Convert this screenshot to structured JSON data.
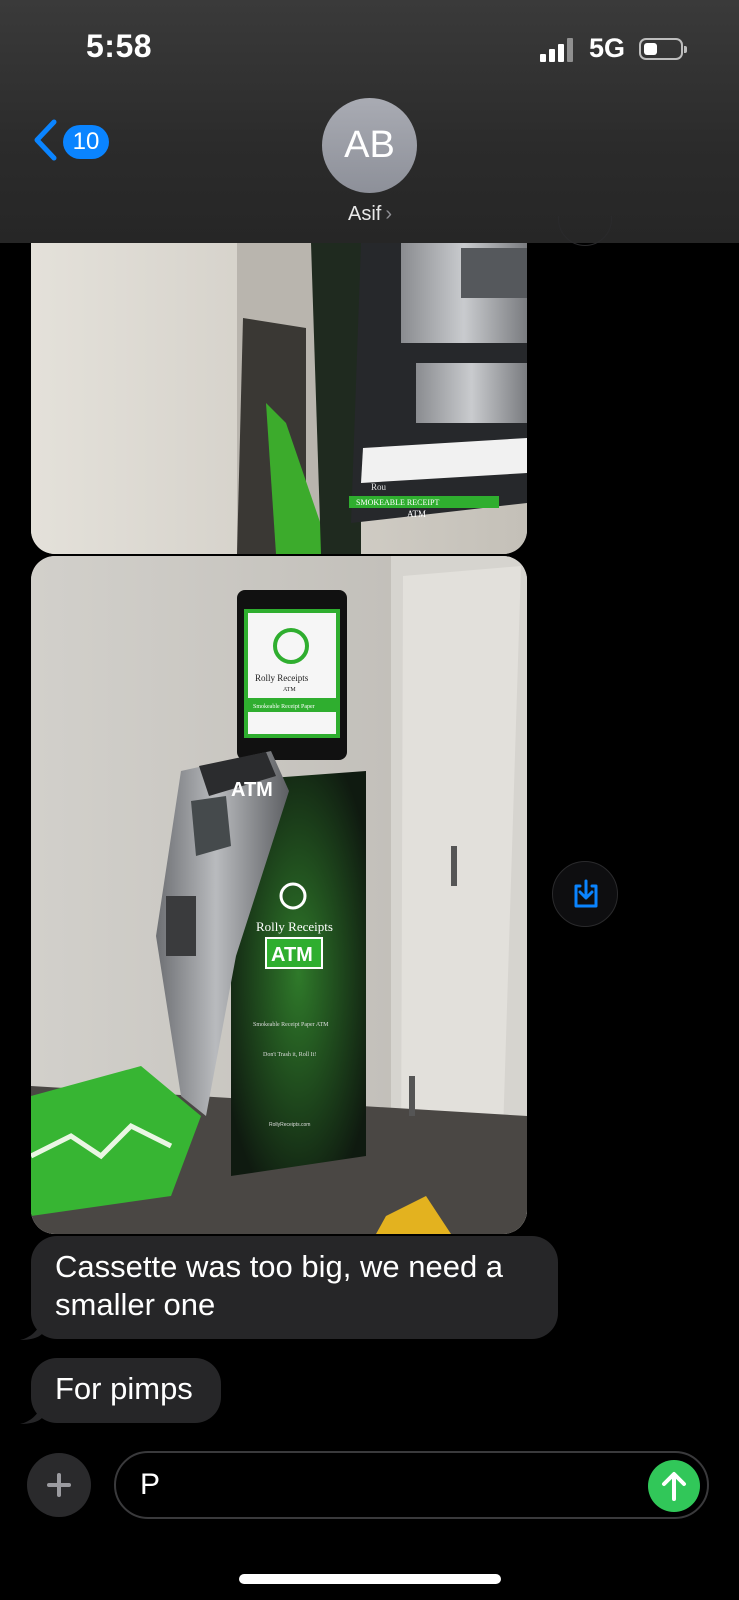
{
  "status_bar": {
    "time": "5:58",
    "network": "5G"
  },
  "header": {
    "unread_count": "10",
    "avatar_initials": "AB",
    "contact_name": "Asif"
  },
  "photo1": {
    "sign_brand": "Rou",
    "sign_line1": "SMOKEABLE RECEIPT",
    "sign_line2": "ATM"
  },
  "photo2": {
    "screen_brand": "Rolly Receipts",
    "screen_sub": "ATM",
    "screen_strip": "Smokeable Receipt Paper",
    "topper_label": "ATM",
    "cabinet_brand": "Rolly Receipts",
    "cabinet_atm": "ATM",
    "cabinet_line1": "Smokeable Receipt Paper ATM",
    "cabinet_line2": "Don't Trash it, Roll It!",
    "cabinet_site": "RollyReceipts.com"
  },
  "messages": [
    {
      "text": "Cassette was too big,  we need a smaller one"
    },
    {
      "text": "For pimps"
    }
  ],
  "compose": {
    "text": "P"
  },
  "colors": {
    "accent": "#0a84ff",
    "send": "#31c759",
    "bubble": "#262628",
    "atm_green": "#2fae2f"
  },
  "icons": {
    "back": "chevron-left-icon",
    "save": "save-to-photos-icon",
    "plus": "plus-icon",
    "send": "arrow-up-icon"
  }
}
